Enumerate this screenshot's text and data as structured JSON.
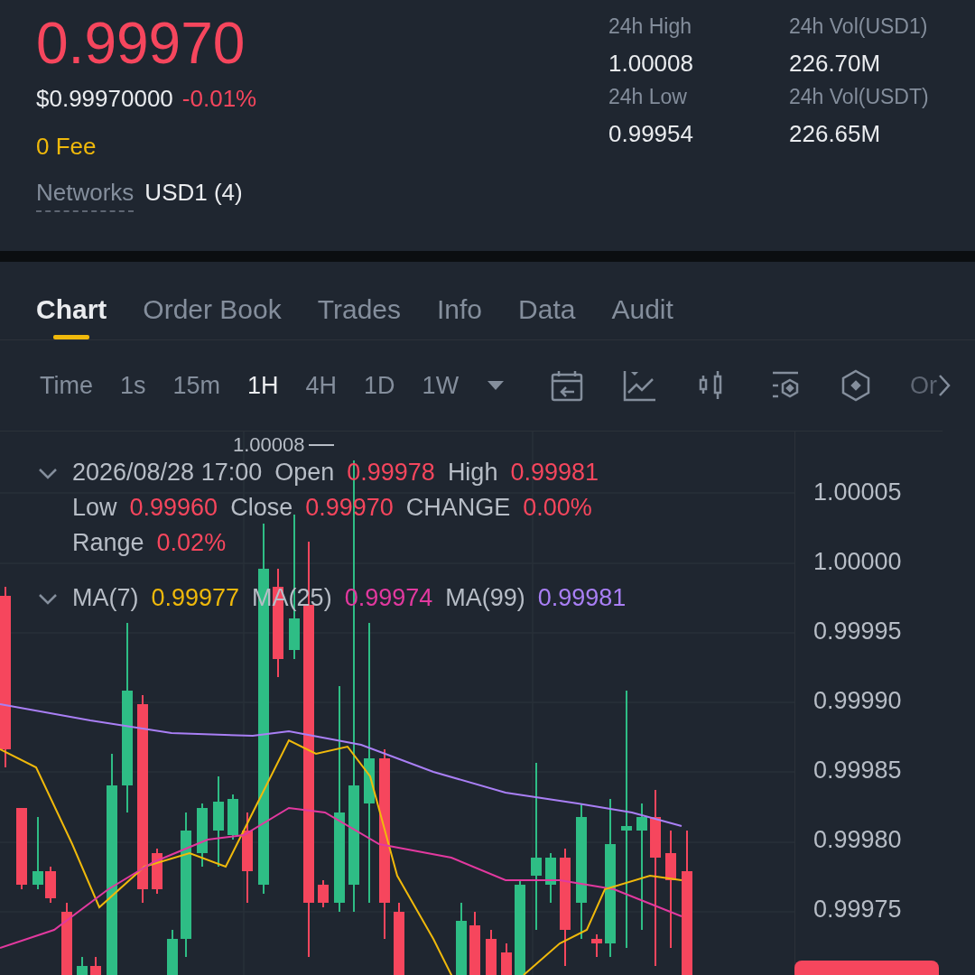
{
  "ticker": {
    "price": "0.99970",
    "usd_price": "$0.99970000",
    "change": "-0.01%",
    "fee": "0 Fee",
    "networks_label": "Networks",
    "networks_value": "USD1 (4)"
  },
  "stats": [
    {
      "label": "24h High",
      "value": "1.00008"
    },
    {
      "label": "24h Vol(USD1)",
      "value": "226.70M"
    },
    {
      "label": "24h Low",
      "value": "0.99954"
    },
    {
      "label": "24h Vol(USDT)",
      "value": "226.65M"
    }
  ],
  "tabs": [
    {
      "label": "Chart",
      "selected": true
    },
    {
      "label": "Order Book",
      "selected": false
    },
    {
      "label": "Trades",
      "selected": false
    },
    {
      "label": "Info",
      "selected": false
    },
    {
      "label": "Data",
      "selected": false
    },
    {
      "label": "Audit",
      "selected": false
    }
  ],
  "toolbar": {
    "time_label": "Time",
    "intervals": [
      {
        "label": "1s",
        "selected": false
      },
      {
        "label": "15m",
        "selected": false
      },
      {
        "label": "1H",
        "selected": true
      },
      {
        "label": "4H",
        "selected": false
      },
      {
        "label": "1D",
        "selected": false
      },
      {
        "label": "1W",
        "selected": false
      }
    ],
    "overflow_text": "Or"
  },
  "chart": {
    "high_marker": "1.00008",
    "datetime": "2026/08/28 17:00",
    "ohlc": [
      {
        "label": "Open",
        "value": "0.99978"
      },
      {
        "label": "High",
        "value": "0.99981"
      },
      {
        "label": "Low",
        "value": "0.99960"
      },
      {
        "label": "Close",
        "value": "0.99970"
      },
      {
        "label": "CHANGE",
        "value": "0.00%"
      },
      {
        "label": "Range",
        "value": "0.02%"
      }
    ],
    "ma": [
      {
        "label": "MA(7)",
        "value": "0.99977",
        "color": "#f0b90b"
      },
      {
        "label": "MA(25)",
        "value": "0.99974",
        "color": "#e2399f"
      },
      {
        "label": "MA(99)",
        "value": "0.99981",
        "color": "#a97ff5"
      }
    ],
    "price_axis": [
      "1.00005",
      "1.00000",
      "0.99995",
      "0.99990",
      "0.99985",
      "0.99980",
      "0.99975"
    ]
  }
}
